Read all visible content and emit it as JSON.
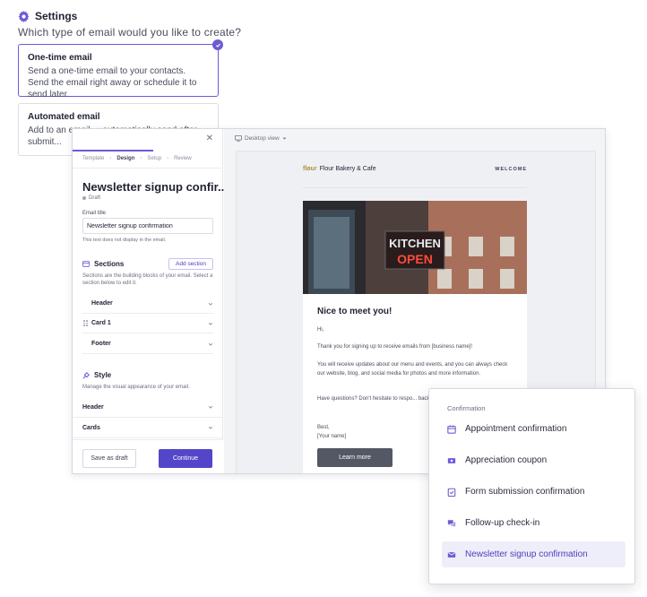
{
  "settings": {
    "title": "Settings",
    "question": "Which type of email would you like to create?"
  },
  "email_types": [
    {
      "title": "One-time email",
      "description": "Send a one-time email to your contacts. Send the email right away or schedule it to send later.",
      "selected": true
    },
    {
      "title": "Automated email",
      "description": "Add to an email ... automatically send after submit...",
      "selected": false
    }
  ],
  "editor": {
    "steps": [
      "Template",
      "Design",
      "Setup",
      "Review"
    ],
    "active_step": "Design",
    "email_title_heading": "Newsletter signup confir...",
    "status": "Draft",
    "email_title_label": "Email title",
    "email_title_value": "Newsletter signup confirmation",
    "email_title_helper": "This text does not display in the email.",
    "sections_heading": "Sections",
    "add_section_label": "Add section",
    "sections_description": "Sections are the building blocks of your email. Select a section below to edit it.",
    "sections": [
      "Header",
      "Card 1",
      "Footer"
    ],
    "style_heading": "Style",
    "style_description": "Manage the visual appearance of your email.",
    "style_items": [
      "Header",
      "Cards"
    ],
    "save_draft_label": "Save as draft",
    "continue_label": "Continue"
  },
  "preview": {
    "view_label": "Desktop view",
    "brand_logo": "fløur",
    "brand_name": "Flour Bakery & Cafe",
    "welcome_label": "WELCOME",
    "hero_sign_top": "KITCHEN",
    "hero_sign_bottom": "OPEN",
    "greeting": "Nice to meet you!",
    "hi": "Hi,",
    "p1": "Thank you for signing up to receive emails from [business name]!",
    "p2": "You will receive updates about our menu and events, and you can always check our website, blog, and social media for photos and more information.",
    "p3": "Have questions? Don't hesitate to respo... back to you as soon as we can.",
    "sign_off": "Best,",
    "signature": "[Your name]",
    "cta_label": "Learn more"
  },
  "dropdown": {
    "heading": "Confirmation",
    "items": [
      {
        "label": "Appointment confirmation",
        "icon": "calendar-icon"
      },
      {
        "label": "Appreciation coupon",
        "icon": "coupon-icon"
      },
      {
        "label": "Form submission confirmation",
        "icon": "clipboard-check-icon"
      },
      {
        "label": "Follow-up check-in",
        "icon": "chat-icon"
      },
      {
        "label": "Newsletter signup confirmation",
        "icon": "envelope-icon",
        "highlighted": true
      }
    ]
  },
  "colors": {
    "accent": "#6b5bd6",
    "primary_button": "#5446c9",
    "cta_button": "#545764"
  }
}
